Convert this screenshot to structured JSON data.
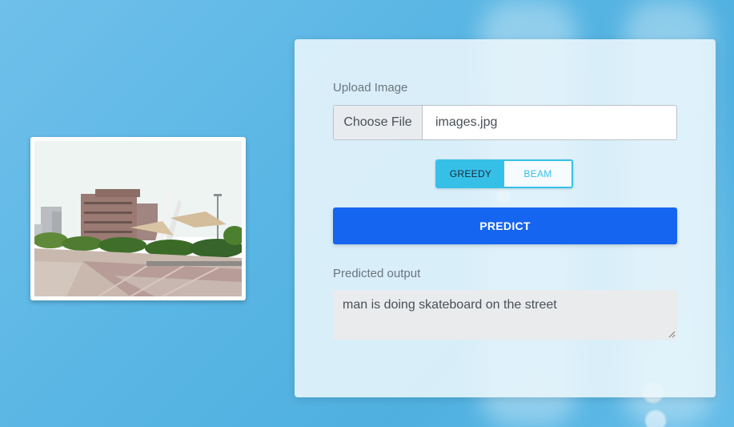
{
  "preview": {
    "image_name": "uploaded-image-preview"
  },
  "form": {
    "upload_label": "Upload Image",
    "file_button_label": "Choose File",
    "file_name": "images.jpg",
    "mode_options": [
      {
        "label": "GREEDY",
        "selected": true
      },
      {
        "label": "BEAM",
        "selected": false
      }
    ],
    "predict_label": "PREDICT",
    "output_label": "Predicted output",
    "output_text": "man is doing skateboard on the street"
  },
  "colors": {
    "accent": "#36c0e8",
    "primary_button": "#1565f0",
    "background": "#5ab6e4"
  }
}
